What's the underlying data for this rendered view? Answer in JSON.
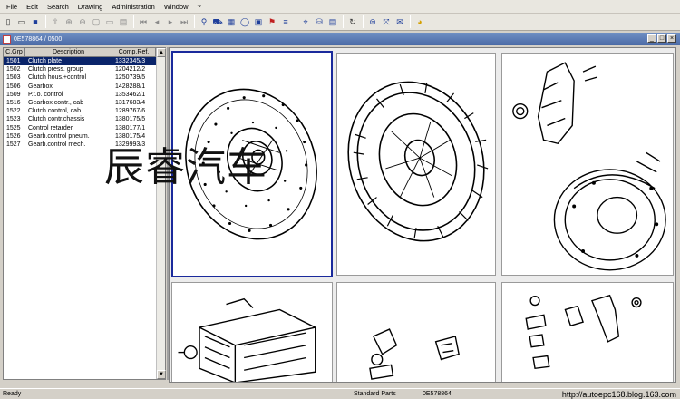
{
  "menu": [
    "File",
    "Edit",
    "Search",
    "Drawing",
    "Administration",
    "Window",
    "?"
  ],
  "document": {
    "title": "0E578864 / 0500"
  },
  "table": {
    "headers": [
      "C.Grp",
      "Description",
      "Comp.Ref."
    ],
    "rows": [
      [
        "1501",
        "Clutch plate",
        "1332345/3"
      ],
      [
        "1502",
        "Clutch press. group",
        "1204212/2"
      ],
      [
        "1503",
        "Clutch hous.+control",
        "1250739/5"
      ],
      [
        "1506",
        "Gearbox",
        "1428288/1"
      ],
      [
        "1509",
        "P.t.o. control",
        "1353462/1"
      ],
      [
        "1516",
        "Gearbox contr., cab",
        "1317683/4"
      ],
      [
        "1522",
        "Clutch control, cab",
        "1289767/6"
      ],
      [
        "1523",
        "Clutch contr.chassis",
        "1380175/5"
      ],
      [
        "1525",
        "Control retarder",
        "1380177/1"
      ],
      [
        "1526",
        "Gearb.control pneum.",
        "1380175/4"
      ],
      [
        "1527",
        "Gearb.control mech.",
        "1329993/3"
      ]
    ],
    "selected_index": 0
  },
  "status": {
    "left": "Ready",
    "middle": "Standard Parts",
    "right": "0E578864",
    "url": "http://autoepc168.blog.163.com"
  },
  "watermark": "辰睿汽车",
  "window_controls": [
    "_",
    "□",
    "×"
  ],
  "colors": {
    "selection": "#0a246a",
    "title_bar": "#4b6aa6",
    "selected_border": "#1a2a9c"
  }
}
